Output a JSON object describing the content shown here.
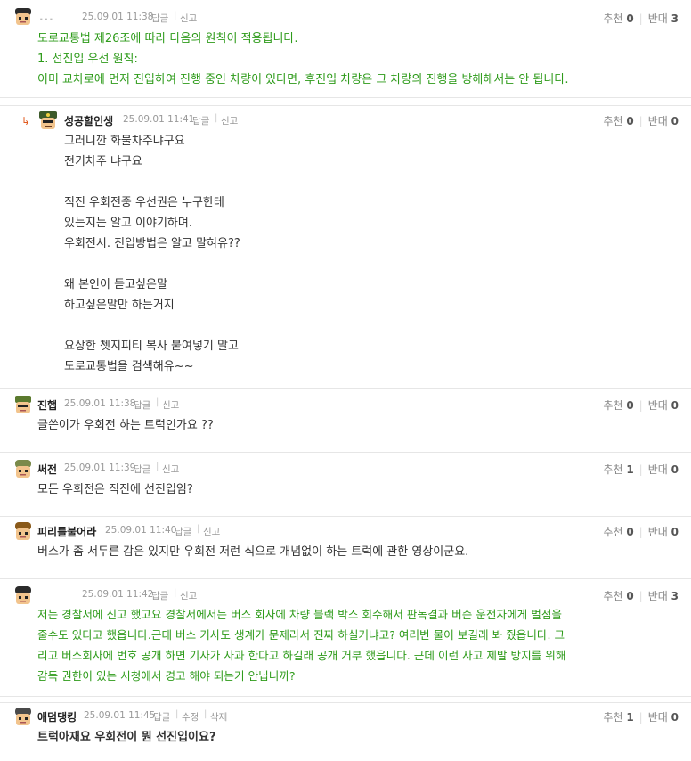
{
  "labels": {
    "reply": "답글",
    "report": "신고",
    "edit": "수정",
    "delete": "삭제",
    "upvote": "추천",
    "downvote": "반대"
  },
  "comments": [
    {
      "nick": "...",
      "time": "25.09.01 11:38",
      "up": "0",
      "down": "3",
      "lines": [
        "도로교통법 제26조에 따라 다음의 원칙이 적용됩니다.",
        "1. 선진입 우선 원칙:",
        "이미 교차로에 먼저 진입하여 진행 중인 차량이 있다면, 후진입 차량은 그 차량의 진행을 방해해서는 안 됩니다."
      ]
    },
    {
      "nick": "성공할인생",
      "time": "25.09.01 11:41",
      "up": "0",
      "down": "0",
      "lines": [
        "그러니깐 화물차주냐구요",
        "전기차주 냐구요",
        "",
        "직진 우회전중 우선권은 누구한테",
        "있는지는 알고 이야기하며.",
        "우회전시. 진입방법은 알고 말혀유??",
        "",
        "왜 본인이 듣고싶은말",
        "하고싶은말만 하는거지",
        "",
        "요상한 쳇지피티 복사 붙여넣기 말고",
        "도로교통법을 검색해유~~"
      ]
    },
    {
      "nick": "진햅",
      "time": "25.09.01 11:38",
      "up": "0",
      "down": "0",
      "lines": [
        "글쓴이가 우회전 하는 트럭인가요 ??"
      ]
    },
    {
      "nick": "써전",
      "time": "25.09.01 11:39",
      "up": "1",
      "down": "0",
      "lines": [
        "모든 우회전은 직진에 선진입임?"
      ]
    },
    {
      "nick": "피리를불어라",
      "time": "25.09.01 11:40",
      "up": "0",
      "down": "0",
      "lines": [
        "버스가 좀 서두른 감은 있지만 우회전 저런 식으로 개념없이 하는 트럭에 관한 영상이군요."
      ]
    },
    {
      "nick": "",
      "time": "25.09.01 11:42",
      "up": "0",
      "down": "3",
      "lines": [
        "저는 경찰서에 신고 했고요 경찰서에서는 버스 회사에 차량 블랙 박스 회수해서 판독결과 버슨 운전자에게 벌점을",
        "줄수도 있다고 했읍니다.근데 버스 기사도 생계가 문제라서 진짜 하실거냐고? 여러번 물어 보길래 봐 줬읍니다. 그",
        "리고 버스회사에 번호 공개 하면 기사가 사과 한다고 하길래 공개 거부 했읍니다. 근데 이런 사고 제발 방지를 위해",
        "감독 권한이 있는 시청에서 경고 해야 되는거 안닙니까?"
      ]
    },
    {
      "nick": "애덤댕킹",
      "time": "25.09.01 11:45",
      "up": "1",
      "down": "0",
      "lines": [
        "트럭아재요 우회전이 뭔 선진입이요?"
      ]
    }
  ],
  "colors": {
    "green_text": "#2e9b1a",
    "reply_arrow": "#e15a1e",
    "meta": "#999999"
  }
}
